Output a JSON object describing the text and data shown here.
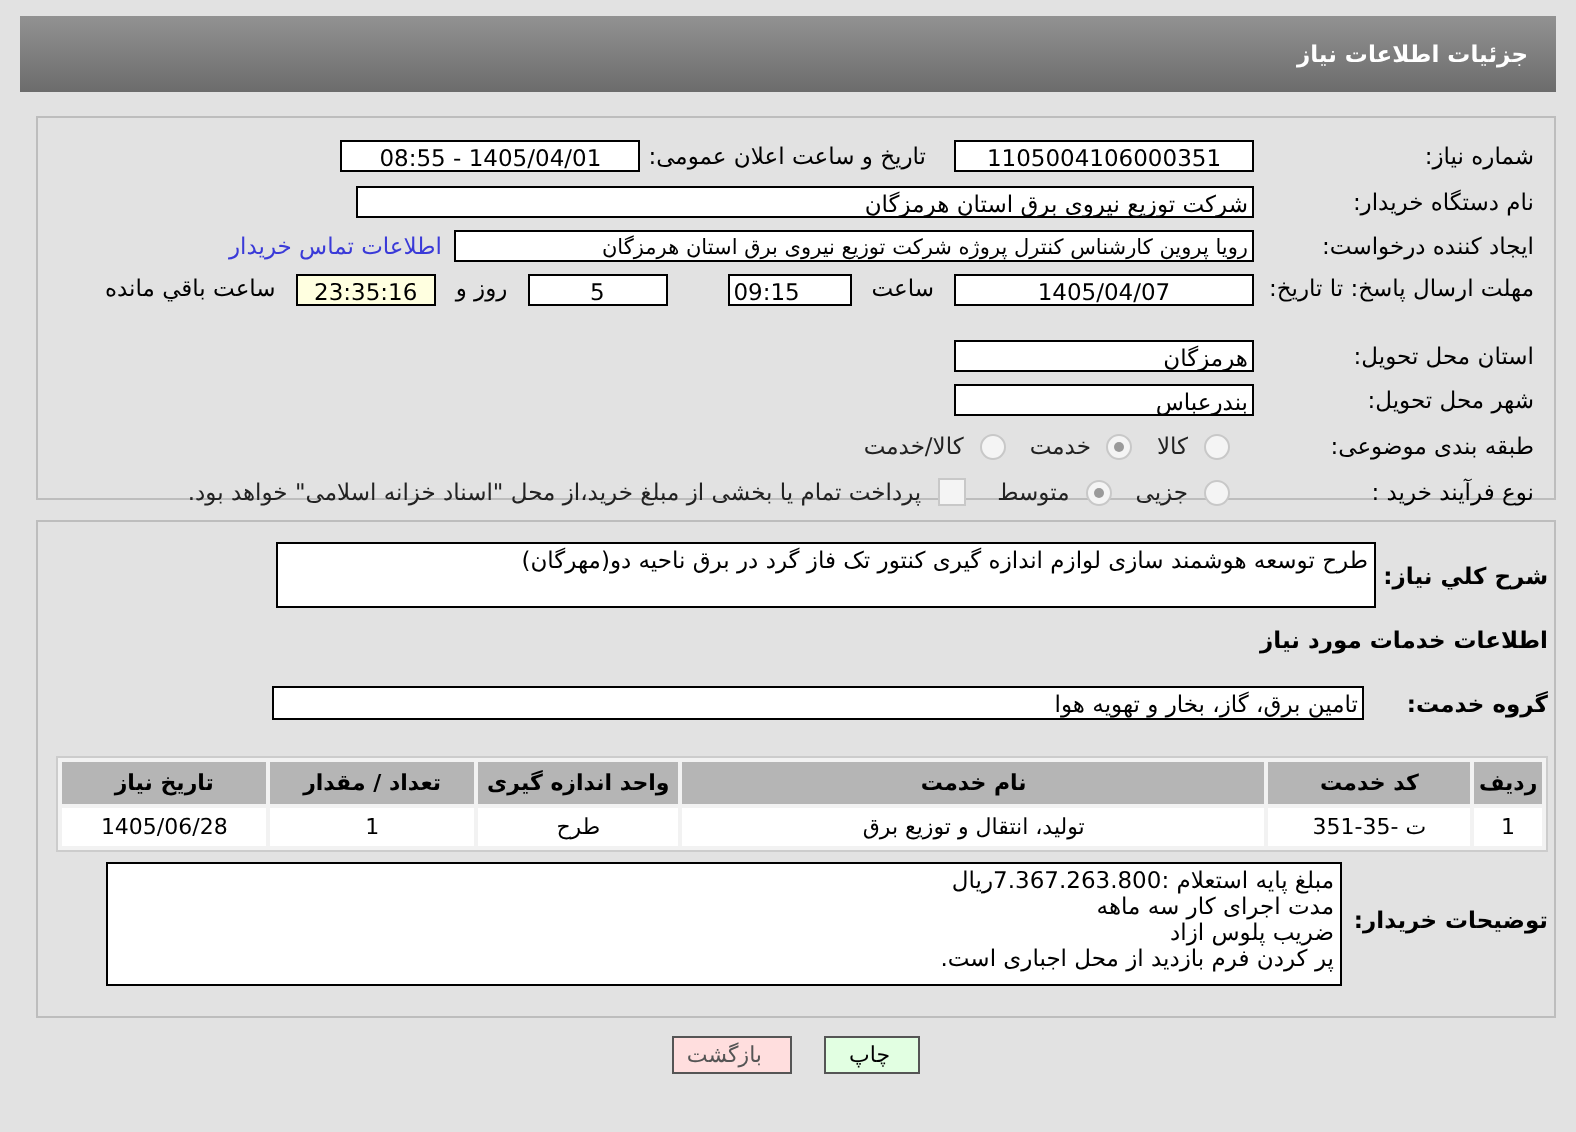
{
  "header": {
    "title": "جزئیات اطلاعات نیاز"
  },
  "need_number": {
    "label": "شماره نیاز:",
    "value": "1105004106000351"
  },
  "announce": {
    "label": "تاریخ و ساعت اعلان عمومی:",
    "value": "1405/04/01 - 08:55"
  },
  "buyer_org": {
    "label": "نام دستگاه خریدار:",
    "value": "شرکت توزیع نیروی برق استان هرمزگان"
  },
  "requester": {
    "label": "ایجاد کننده درخواست:",
    "value": "رویا پروین کارشناس کنترل پروژه شرکت توزیع نیروی برق استان هرمزگان",
    "link": "اطلاعات تماس خریدار"
  },
  "deadline": {
    "label": "مهلت ارسال پاسخ: تا تاریخ:",
    "date": "1405/04/07",
    "time_label": "ساعت",
    "time": "09:15",
    "days": "5",
    "days_label": "روز و",
    "remaining": "23:35:16",
    "remaining_label": "ساعت باقي مانده"
  },
  "province": {
    "label": "استان محل تحویل:",
    "value": "هرمزگان"
  },
  "city": {
    "label": "شهر محل تحویل:",
    "value": "بندرعباس"
  },
  "category": {
    "label": "طبقه بندی موضوعی:",
    "options": [
      {
        "label": "کالا",
        "selected": false
      },
      {
        "label": "خدمت",
        "selected": true
      },
      {
        "label": "کالا/خدمت",
        "selected": false
      }
    ]
  },
  "purchase_type": {
    "label": "نوع فرآیند خرید :",
    "options": [
      {
        "label": "جزیی",
        "selected": false
      },
      {
        "label": "متوسط",
        "selected": true
      }
    ],
    "payment": {
      "label": "پرداخت تمام یا بخشی از مبلغ خرید،از محل \"اسناد خزانه اسلامی\" خواهد بود.",
      "checked": false
    }
  },
  "description": {
    "label": "شرح کلي نیاز:",
    "value": "طرح توسعه هوشمند سازی لوازم اندازه گیری کنتور تک فاز گرد در برق ناحیه دو(مهرگان)"
  },
  "services_title": "اطلاعات خدمات مورد نیاز",
  "service_group": {
    "label": "گروه خدمت:",
    "value": "تامین برق، گاز، بخار و تهویه هوا"
  },
  "table": {
    "columns": [
      "ردیف",
      "کد خدمت",
      "نام خدمت",
      "واحد اندازه گیری",
      "تعداد / مقدار",
      "تاریخ نیاز"
    ],
    "rows": [
      [
        "1",
        "ت -35-351",
        "تولید، انتقال و توزیع برق",
        "طرح",
        "1",
        "1405/06/28"
      ]
    ]
  },
  "buyer_notes": {
    "label": "توضیحات خریدار:",
    "value": "مبلغ پایه استعلام :7.367.263.800ریال\nمدت اجرای کار سه ماهه\nضریب پلوس ازاد\nپر کردن فرم بازدید از محل اجباری است."
  },
  "buttons": [
    {
      "label": "چاپ",
      "kind": "print"
    },
    {
      "label": "بازگشت",
      "kind": "back"
    }
  ]
}
